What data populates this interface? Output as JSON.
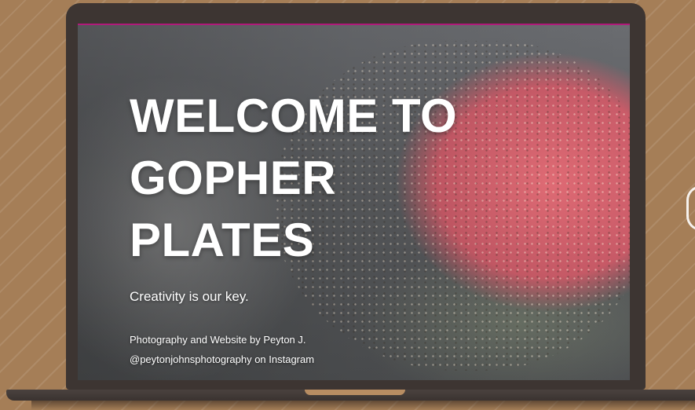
{
  "hero": {
    "title_lines": [
      "WELCOME TO",
      "GOPHER",
      "PLATES"
    ]
  },
  "tagline": "Creativity is our key.",
  "credits": {
    "line1": "Photography and Website by Peyton J.",
    "line2": "@peytonjohnsphotography on Instagram"
  },
  "colors": {
    "background": "#a57e57",
    "laptop_frame": "#3d3532",
    "screen_top_accent": "#b01a7a",
    "text": "#ffffff"
  },
  "hero_image": "raw-burger-patty-on-griddle"
}
